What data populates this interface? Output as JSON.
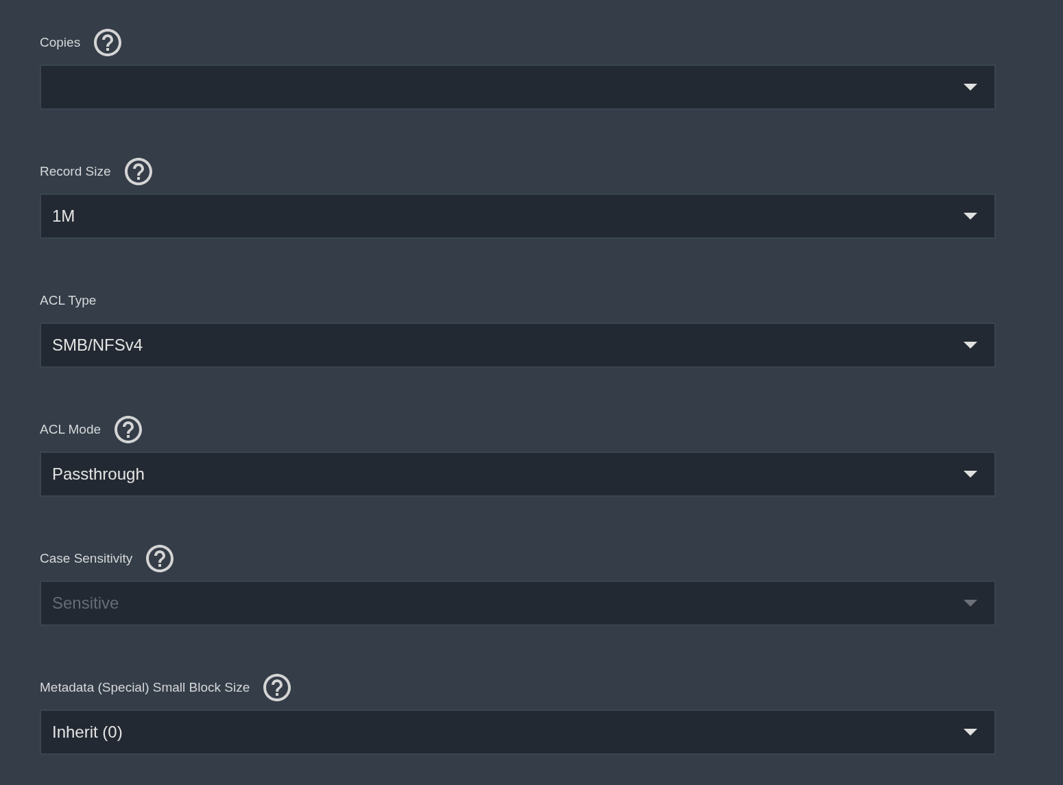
{
  "fields": [
    {
      "label": "Copies",
      "help_icon": true,
      "disabled": false
    },
    {
      "label": "Record Size",
      "help_icon": true,
      "disabled": false,
      "value": "1M"
    },
    {
      "label": "ACL Type",
      "help_icon": false,
      "disabled": false,
      "value": "SMB/NFSv4"
    },
    {
      "label": "ACL Mode",
      "help_icon": true,
      "disabled": false,
      "value": "Passthrough"
    },
    {
      "label": "Case Sensitivity",
      "help_icon": true,
      "disabled": true,
      "value": "Sensitive"
    },
    {
      "label": "Metadata (Special) Small Block Size",
      "help_icon": true,
      "disabled": false,
      "value": "Inherit (0)"
    }
  ]
}
